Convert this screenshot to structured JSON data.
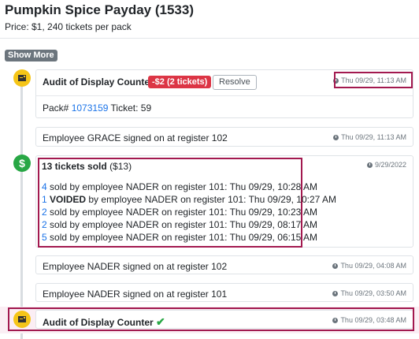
{
  "header": {
    "title": "Pumpkin Spice Payday (1533)",
    "price": "Price: $1, 240 tickets per pack",
    "show_more": "Show More"
  },
  "events": {
    "audit1": {
      "title": "Audit of Display Counter",
      "badge": "-$2 (2 tickets)",
      "resolve": "Resolve",
      "timestamp": "Thu 09/29, 11:13 AM",
      "pack_label": "Pack#",
      "pack_number": "1073159",
      "ticket_text": "Ticket: 59"
    },
    "signon_grace": {
      "text": "Employee GRACE signed on at register 102",
      "timestamp": "Thu 09/29, 11:13 AM"
    },
    "sold": {
      "title": "13 tickets sold",
      "amount": "($13)",
      "date": "9/29/2022",
      "lines": [
        {
          "count": "4",
          "pre": "",
          "text": " sold by employee NADER on register 101: Thu 09/29, 10:28 AM"
        },
        {
          "count": "1",
          "pre": "VOIDED",
          "text": " by employee NADER on register 101: Thu 09/29, 10:27 AM"
        },
        {
          "count": "2",
          "pre": "",
          "text": " sold by employee NADER on register 101: Thu 09/29, 10:23 AM"
        },
        {
          "count": "2",
          "pre": "",
          "text": " sold by employee NADER on register 101: Thu 09/29, 08:17 AM"
        },
        {
          "count": "5",
          "pre": "",
          "text": " sold by employee NADER on register 101: Thu 09/29, 06:15 AM"
        }
      ]
    },
    "signon_nader_102": {
      "text": "Employee NADER signed on at register 102",
      "timestamp": "Thu 09/29, 04:08 AM"
    },
    "signon_nader_101": {
      "text": "Employee NADER signed on at register 101",
      "timestamp": "Thu 09/29, 03:50 AM"
    },
    "audit2": {
      "title": "Audit of Display Counter",
      "timestamp": "Thu 09/29, 03:48 AM"
    }
  },
  "icons": {
    "ticket": "ticket-icon",
    "dollar": "dollar-icon",
    "clock": "clock-icon",
    "check": "check-icon"
  },
  "colors": {
    "highlight": "#a2194f",
    "badge_red": "#dc3545",
    "ticket_yellow": "#f5c518",
    "dollar_green": "#28a745",
    "link_blue": "#1a73e8"
  }
}
